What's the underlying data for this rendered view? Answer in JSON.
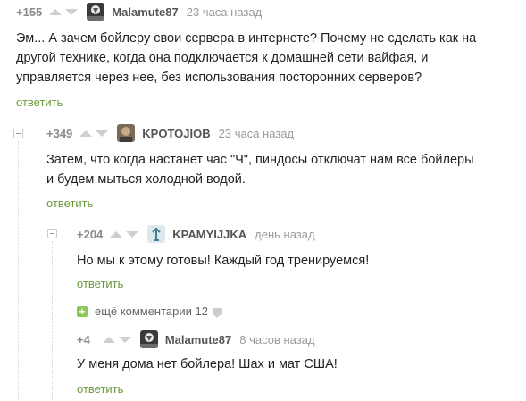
{
  "comments": [
    {
      "rating": "+155",
      "author": "Malamute87",
      "time": "23 часа назад",
      "text_lines": [
        "Эм... А зачем бойлеру свои сервера в интернете? Почему не сделать как на",
        "другой технике, когда она подключается к домашней сети вайфая, и",
        "управляется через нее, без использования посторонних серверов?"
      ],
      "reply_label": "ответить"
    },
    {
      "rating": "+349",
      "author": "KPOTOJIOB",
      "time": "23 часа назад",
      "text_lines": [
        "Затем, что когда настанет час \"Ч\", пиндосы отключат нам все бойлеры",
        "и будем мыться холодной водой."
      ],
      "reply_label": "ответить"
    },
    {
      "rating": "+204",
      "author": "KPAMYIJJKA",
      "time": "день назад",
      "text_lines": [
        "Но мы к этому готовы! Каждый год тренируемся!"
      ],
      "reply_label": "ответить"
    },
    {
      "rating": "+4",
      "author": "Malamute87",
      "time": "8 часов назад",
      "text_lines": [
        "У меня дома нет бойлера! Шах и мат США!"
      ],
      "reply_label": "ответить"
    }
  ],
  "more_comments": {
    "label": "ещё комментарии 12",
    "plus": "+"
  },
  "icons": {
    "vote_up": "triangle-up",
    "vote_down": "triangle-down",
    "collapse": "minus-box",
    "comments": "speech-bubble"
  },
  "colors": {
    "reply_link": "#6b9a3b",
    "plus_box": "#8ac858",
    "vote_arrows": "#cfcfcf"
  }
}
